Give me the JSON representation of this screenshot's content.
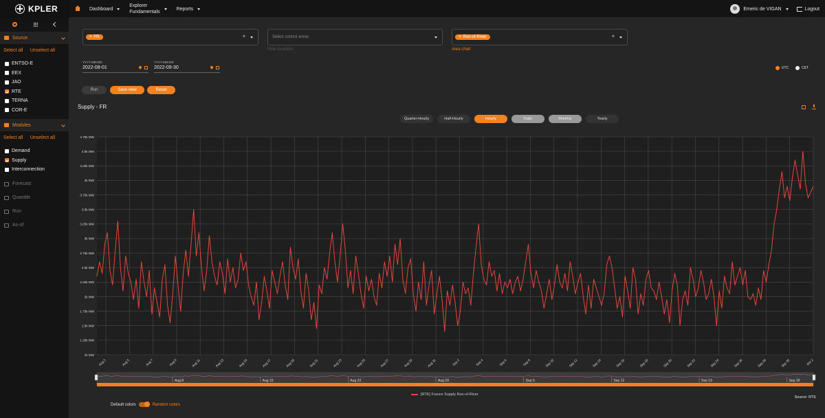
{
  "brand": {
    "name": "KPLER"
  },
  "nav": {
    "dashboard": "Dashboard",
    "explorer_line1": "Explorer",
    "explorer_line2": "Fundamentals",
    "reports": "Reports"
  },
  "user": {
    "name": "Emeric de VIGAN",
    "logout": "Logout"
  },
  "sidebar": {
    "source": {
      "title": "Source",
      "select_all": "Select all",
      "unselect_all": "Unselect all",
      "items": [
        {
          "label": "ENTSO-E",
          "checked": false
        },
        {
          "label": "EEX",
          "checked": false
        },
        {
          "label": "JAO",
          "checked": false
        },
        {
          "label": "RTE",
          "checked": true
        },
        {
          "label": "TERNA",
          "checked": false
        },
        {
          "label": "COR-E",
          "checked": false
        }
      ]
    },
    "modules": {
      "title": "Modules",
      "select_all": "Select all",
      "unselect_all": "Unselect all",
      "items": [
        {
          "label": "Demand",
          "checked": false
        },
        {
          "label": "Supply",
          "checked": true
        },
        {
          "label": "Interconnection",
          "checked": false
        }
      ]
    },
    "tools": [
      "Forecast",
      "Quantile",
      "Run",
      "As-of"
    ]
  },
  "filters": {
    "country_chip": "FR",
    "control_areas_placeholder": "Select control areas",
    "hide_locations": "Hide locations",
    "fuel_chip": "Run-of-River",
    "area_chart": "Area chart",
    "clear": "×",
    "chip_x": "×"
  },
  "dates": {
    "format": "YYYY-MM-DD",
    "start": "2022-08-01",
    "end": "2022-09-30"
  },
  "timezone": {
    "utc": "UTC",
    "cet": "CET"
  },
  "actions": {
    "run": "Run",
    "save_view": "Save view",
    "reset": "Reset"
  },
  "panel": {
    "title": "Supply - FR"
  },
  "granularity": [
    "Quarter-Hourly",
    "Half-Hourly",
    "Hourly",
    "Daily",
    "Monthly",
    "Yearly"
  ],
  "colors": {
    "accent": "#f5821f",
    "series": "#e6463c",
    "panel": "#262626"
  },
  "legend": {
    "series": "[RTE] France Supply Run-of-River",
    "source": "Source: RTE"
  },
  "color_toggle": {
    "left": "Default colors",
    "right": "Random colors"
  },
  "chart_data": {
    "type": "line",
    "ylim": [
      1000,
      4750
    ],
    "y_ticks": [
      "1k MW",
      "1.25k MW",
      "1.5k MW",
      "1.75k MW",
      "2k MW",
      "2.25k MW",
      "2.5k MW",
      "2.75k MW",
      "3k MW",
      "3.25k MW",
      "3.5k MW",
      "3.75k MW",
      "4k MW",
      "4.25k MW",
      "4.5k MW",
      "4.75k MW"
    ],
    "x_ticks": [
      "Aug 3",
      "Aug 5",
      "Aug 7",
      "Aug 9",
      "Aug 11",
      "Aug 13",
      "Aug 15",
      "Aug 17",
      "Aug 19",
      "Aug 21",
      "Aug 23",
      "Aug 25",
      "Aug 27",
      "Aug 29",
      "Aug 31",
      "Sep 2",
      "Sep 4",
      "Sep 6",
      "Sep 8",
      "Sep 10",
      "Sep 12",
      "Sep 14",
      "Sep 16",
      "Sep 18",
      "Sep 20",
      "Sep 22",
      "Sep 24",
      "Sep 26",
      "Sep 28",
      "Sep 30",
      "Oct 2"
    ],
    "navigator_ticks": [
      "Aug 8",
      "Aug 15",
      "Aug 22",
      "Aug 29",
      "Sep 5",
      "Sep 12",
      "Sep 19",
      "Sep 26"
    ],
    "series": [
      {
        "name": "[RTE] France Supply Run-of-River",
        "values": [
          2350,
          2600,
          2400,
          2900,
          3100,
          2450,
          2200,
          2800,
          3300,
          2500,
          2100,
          2700,
          2400,
          2250,
          1950,
          2300,
          1800,
          2600,
          2250,
          2000,
          2450,
          1700,
          2150,
          1900,
          1650,
          2300,
          2550,
          1850,
          1550,
          2050,
          2700,
          2200,
          1750,
          2400,
          2800,
          2350,
          2900,
          3500,
          2700,
          3100,
          2500,
          2100,
          2450,
          3050,
          2600,
          2350,
          2200,
          2600,
          2400,
          2050,
          2650,
          2250,
          2500,
          2150,
          2300,
          2750,
          2450,
          2600,
          2200,
          2000,
          1850,
          2250,
          1600,
          1900,
          2350,
          2100,
          1800,
          2450,
          2250,
          2050,
          2350,
          2600,
          2200,
          1950,
          2850,
          2500,
          2300,
          2650,
          2100,
          1800,
          2400,
          2100,
          1600,
          1900,
          1450,
          2200,
          2050,
          2500,
          2300,
          2750,
          3100,
          2600,
          2250,
          2700,
          3250,
          2800,
          2150,
          2450,
          2050,
          2700,
          2400,
          2050,
          1800,
          2350,
          2100,
          2300,
          2000,
          1850,
          2400,
          2150,
          2600,
          2350,
          2700,
          2250,
          2900,
          2550,
          3000,
          2300,
          2050,
          2500,
          2650,
          2050,
          1750,
          2250,
          1950,
          2600,
          1850,
          2200,
          2450,
          1700,
          2050,
          2350,
          1950,
          1400,
          2100,
          1850,
          2200,
          1900,
          1500,
          1750,
          2250,
          2050,
          2150,
          1850,
          2400,
          2850,
          3250,
          2550,
          2300,
          2200,
          2600,
          2350,
          2450,
          2100,
          2400,
          2050,
          2250,
          2150,
          2300,
          2050,
          2250,
          2350,
          2100,
          2300,
          2600,
          2900,
          2400,
          2150,
          2450,
          2250,
          2100,
          1800,
          2050,
          2300,
          1950,
          2200,
          2550,
          2250,
          2150,
          2400,
          2100,
          2600,
          2350,
          2050,
          2250,
          2400,
          2000,
          1700,
          2200,
          1800,
          2300,
          2150,
          2000,
          1850,
          2050,
          2550,
          2700,
          2500,
          2150,
          1800,
          2000,
          1650,
          2350,
          2100,
          1800,
          2500,
          2300,
          1700,
          2050,
          1850,
          2300,
          2450,
          2150,
          2100,
          1950,
          2250,
          2000,
          1700,
          1950,
          1550,
          2100,
          2400,
          2200,
          1500,
          1950,
          2100,
          1850,
          2500,
          2300,
          2000,
          2150,
          2450,
          2250,
          1950,
          2050,
          2300,
          2000,
          1500,
          2100,
          1800,
          2350,
          2150,
          2050,
          2600,
          2200,
          2350,
          2500,
          2200,
          2450,
          2000,
          1950,
          2050,
          1850,
          2150,
          1950,
          2450,
          2250,
          2550,
          2800,
          3250,
          3500,
          3850,
          4150,
          3700,
          3900,
          3650,
          4050,
          4350,
          4100,
          3850,
          4500,
          3950,
          3700,
          3800,
          3900
        ]
      }
    ]
  }
}
